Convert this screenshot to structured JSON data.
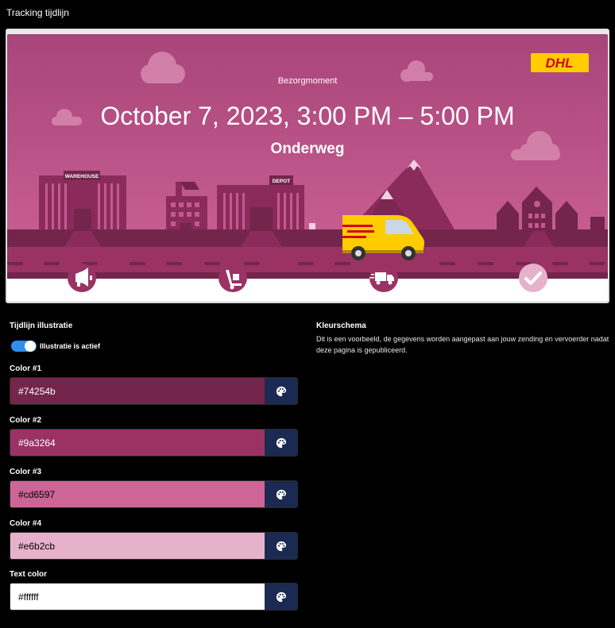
{
  "page_title": "Tracking tijdlijn",
  "preview": {
    "delivery_label": "Bezorgmoment",
    "delivery_window": "October 7, 2023, 3:00 PM – 5:00 PM",
    "status": "Onderweg",
    "carrier_logo": "DHL",
    "warehouse_sign": "WAREHOUSE",
    "depot_sign": "DEPOT",
    "timeline_steps": [
      {
        "icon": "megaphone-icon",
        "completed": true
      },
      {
        "icon": "hand-truck-icon",
        "completed": true
      },
      {
        "icon": "delivery-truck-icon",
        "completed": true
      },
      {
        "icon": "checkmark-icon",
        "completed": false
      }
    ]
  },
  "illustration": {
    "title": "Tijdlijn illustratie",
    "toggle_label": "Illustratie is actief",
    "toggle_on": true
  },
  "colors": [
    {
      "label": "Color #1",
      "value": "#74254b"
    },
    {
      "label": "Color #2",
      "value": "#9a3264"
    },
    {
      "label": "Color #3",
      "value": "#cd6597"
    },
    {
      "label": "Color #4",
      "value": "#e6b2cb"
    },
    {
      "label": "Text color",
      "value": "#ffffff"
    }
  ],
  "scheme": {
    "title": "Kleurschema",
    "description": "Dit is een voorbeeld, de gegevens worden aangepast aan jouw zending en vervoerder nadat deze pagina is gepubliceerd."
  },
  "theme": {
    "toggle_color": "#2f8ef0",
    "picker_button_color": "#1b2a52",
    "dhl_yellow": "#ffcc00",
    "dhl_red": "#d40511"
  }
}
